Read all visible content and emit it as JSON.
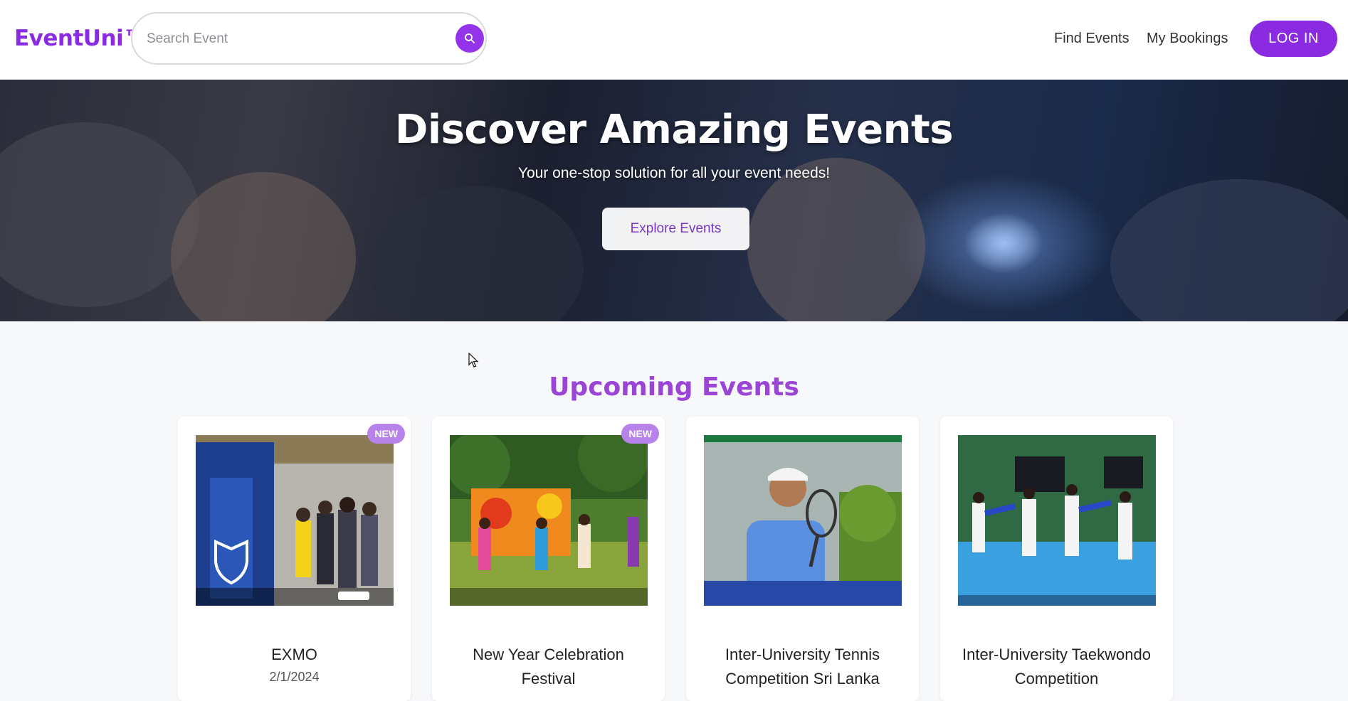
{
  "brand": {
    "name": "EventUni™"
  },
  "search": {
    "placeholder": "Search Event"
  },
  "nav": {
    "find_events": "Find Events",
    "my_bookings": "My Bookings",
    "login": "LOG IN"
  },
  "hero": {
    "title": "Discover Amazing Events",
    "subtitle": "Your one-stop solution for all your event needs!",
    "cta": "Explore Events"
  },
  "section": {
    "title": "Upcoming Events"
  },
  "events": [
    {
      "title": "EXMO",
      "date": "2/1/2024",
      "badge": "NEW"
    },
    {
      "title": "New Year Celebration Festival",
      "date": "",
      "badge": "NEW"
    },
    {
      "title": "Inter-University Tennis Competition Sri Lanka",
      "date": "",
      "badge": ""
    },
    {
      "title": "Inter-University Taekwondo Competition",
      "date": "",
      "badge": ""
    }
  ],
  "colors": {
    "accent": "#8a2be2",
    "section_title": "#9b45d6",
    "badge": "#b783ea"
  },
  "icons": {
    "search": "search-icon",
    "cursor": "mouse-cursor-icon"
  }
}
